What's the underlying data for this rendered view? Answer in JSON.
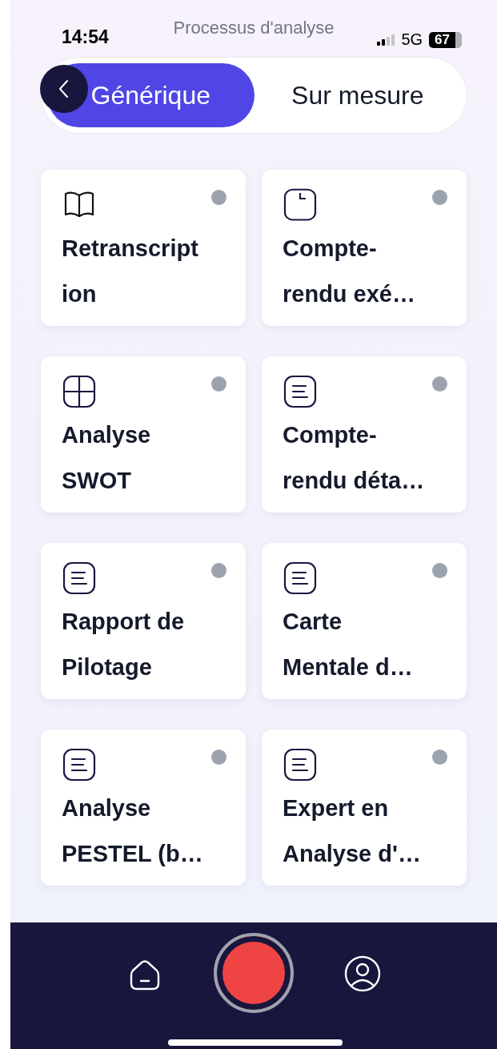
{
  "status_bar": {
    "time": "14:54",
    "title": "Processus d'analyse",
    "network": "5G",
    "battery": "67"
  },
  "tabs": [
    {
      "label": "Générique",
      "selected": true
    },
    {
      "label": "Sur mesure",
      "selected": false
    }
  ],
  "cards": [
    {
      "kind": "book",
      "title": "Retranscription"
    },
    {
      "kind": "clock",
      "title": "Compte-rendu exé…"
    },
    {
      "kind": "grid",
      "title": "Analyse SWOT"
    },
    {
      "kind": "document",
      "title": "Compte-rendu déta…"
    },
    {
      "kind": "document",
      "title": "Rapport de Pilotage"
    },
    {
      "kind": "document",
      "title": "Carte Mentale d…"
    },
    {
      "kind": "document",
      "title": "Analyse PESTEL (b…"
    },
    {
      "kind": "document",
      "title": "Expert en Analyse d'…"
    }
  ]
}
